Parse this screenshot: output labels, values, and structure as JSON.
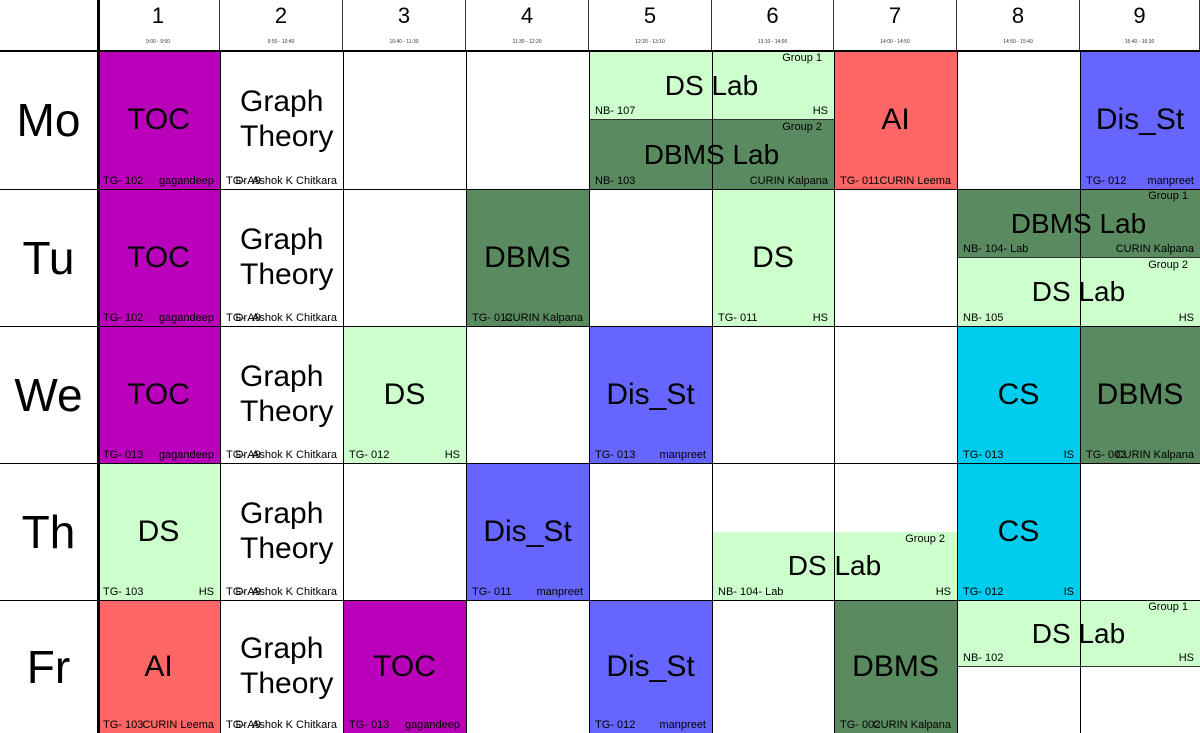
{
  "colors": {
    "toc": "#bb00bb",
    "graph": "#ffffff",
    "ds": "#ccffcc",
    "dbms": "#5a8a5f",
    "ai": "#ff6666",
    "dis": "#6666ff",
    "cs": "#00ccee"
  },
  "periods": [
    {
      "num": "1",
      "time": "9:00 - 9:50"
    },
    {
      "num": "2",
      "time": "9:50 - 10:40"
    },
    {
      "num": "3",
      "time": "10:40 - 11:30"
    },
    {
      "num": "4",
      "time": "11:30 - 12:20"
    },
    {
      "num": "5",
      "time": "12:20 - 13:10"
    },
    {
      "num": "6",
      "time": "13:10 - 14:00"
    },
    {
      "num": "7",
      "time": "14:00 - 14:50"
    },
    {
      "num": "8",
      "time": "14:50 - 15:40"
    },
    {
      "num": "9",
      "time": "15:40 - 16:30"
    }
  ],
  "days": [
    "Mo",
    "Tu",
    "We",
    "Th",
    "Fr"
  ],
  "entries": [
    {
      "day": 0,
      "p": 1,
      "span": 1,
      "part": "full",
      "subject": "TOC",
      "color": "toc",
      "room": "TG- 102",
      "teacher": "gagandeep"
    },
    {
      "day": 0,
      "p": 2,
      "span": 1,
      "part": "full",
      "subject": "Graph Theory",
      "color": "graph",
      "room": "TG- A9",
      "teacher": "Dr. Ashok K Chitkara"
    },
    {
      "day": 0,
      "p": 5,
      "span": 2,
      "part": "top",
      "subject": "DS Lab",
      "group": "Group 1",
      "color": "ds",
      "room": "NB- 107",
      "teacher": "HS"
    },
    {
      "day": 0,
      "p": 5,
      "span": 2,
      "part": "bottom",
      "subject": "DBMS Lab",
      "group": "Group 2",
      "color": "dbms",
      "room": "NB- 103",
      "teacher": "CURIN Kalpana"
    },
    {
      "day": 0,
      "p": 7,
      "span": 1,
      "part": "full",
      "subject": "AI",
      "color": "ai",
      "room": "TG- 011",
      "teacher": "CURIN Leema"
    },
    {
      "day": 0,
      "p": 9,
      "span": 1,
      "part": "full",
      "subject": "Dis_St",
      "color": "dis",
      "room": "TG- 012",
      "teacher": "manpreet"
    },
    {
      "day": 1,
      "p": 1,
      "span": 1,
      "part": "full",
      "subject": "TOC",
      "color": "toc",
      "room": "TG- 102",
      "teacher": "gagandeep"
    },
    {
      "day": 1,
      "p": 2,
      "span": 1,
      "part": "full",
      "subject": "Graph Theory",
      "color": "graph",
      "room": "TG- A9",
      "teacher": "Dr. Ashok K Chitkara"
    },
    {
      "day": 1,
      "p": 4,
      "span": 1,
      "part": "full",
      "subject": "DBMS",
      "color": "dbms",
      "room": "TG- 012",
      "teacher": "CURIN Kalpana"
    },
    {
      "day": 1,
      "p": 6,
      "span": 1,
      "part": "full",
      "subject": "DS",
      "color": "ds",
      "room": "TG- 011",
      "teacher": "HS"
    },
    {
      "day": 1,
      "p": 8,
      "span": 2,
      "part": "top",
      "subject": "DBMS Lab",
      "group": "Group 1",
      "color": "dbms",
      "room": "NB- 104- Lab",
      "teacher": "CURIN Kalpana"
    },
    {
      "day": 1,
      "p": 8,
      "span": 2,
      "part": "bottom",
      "subject": "DS Lab",
      "group": "Group 2",
      "color": "ds",
      "room": "NB- 105",
      "teacher": "HS"
    },
    {
      "day": 2,
      "p": 1,
      "span": 1,
      "part": "full",
      "subject": "TOC",
      "color": "toc",
      "room": "TG- 013",
      "teacher": "gagandeep"
    },
    {
      "day": 2,
      "p": 2,
      "span": 1,
      "part": "full",
      "subject": "Graph Theory",
      "color": "graph",
      "room": "TG- A9",
      "teacher": "Dr. Ashok K Chitkara"
    },
    {
      "day": 2,
      "p": 3,
      "span": 1,
      "part": "full",
      "subject": "DS",
      "color": "ds",
      "room": "TG- 012",
      "teacher": "HS"
    },
    {
      "day": 2,
      "p": 5,
      "span": 1,
      "part": "full",
      "subject": "Dis_St",
      "color": "dis",
      "room": "TG- 013",
      "teacher": "manpreet"
    },
    {
      "day": 2,
      "p": 8,
      "span": 1,
      "part": "full",
      "subject": "CS",
      "color": "cs",
      "room": "TG- 013",
      "teacher": "IS"
    },
    {
      "day": 2,
      "p": 9,
      "span": 1,
      "part": "full",
      "subject": "DBMS",
      "color": "dbms",
      "room": "TG- 003",
      "teacher": "CURIN Kalpana"
    },
    {
      "day": 3,
      "p": 1,
      "span": 1,
      "part": "full",
      "subject": "DS",
      "color": "ds",
      "room": "TG- 103",
      "teacher": "HS"
    },
    {
      "day": 3,
      "p": 2,
      "span": 1,
      "part": "full",
      "subject": "Graph Theory",
      "color": "graph",
      "room": "TG- A9",
      "teacher": "Dr. Ashok K Chitkara"
    },
    {
      "day": 3,
      "p": 4,
      "span": 1,
      "part": "full",
      "subject": "Dis_St",
      "color": "dis",
      "room": "TG- 011",
      "teacher": "manpreet"
    },
    {
      "day": 3,
      "p": 6,
      "span": 2,
      "part": "bottom",
      "subject": "DS Lab",
      "group": "Group 2",
      "color": "ds",
      "room": "NB- 104- Lab",
      "teacher": "HS"
    },
    {
      "day": 3,
      "p": 8,
      "span": 1,
      "part": "full",
      "subject": "CS",
      "color": "cs",
      "room": "TG- 012",
      "teacher": "IS"
    },
    {
      "day": 4,
      "p": 1,
      "span": 1,
      "part": "full",
      "subject": "AI",
      "color": "ai",
      "room": "TG- 103",
      "teacher": "CURIN Leema"
    },
    {
      "day": 4,
      "p": 2,
      "span": 1,
      "part": "full",
      "subject": "Graph Theory",
      "color": "graph",
      "room": "TG- A9",
      "teacher": "Dr. Ashok K Chitkara"
    },
    {
      "day": 4,
      "p": 3,
      "span": 1,
      "part": "full",
      "subject": "TOC",
      "color": "toc",
      "room": "TG- 013",
      "teacher": "gagandeep"
    },
    {
      "day": 4,
      "p": 5,
      "span": 1,
      "part": "full",
      "subject": "Dis_St",
      "color": "dis",
      "room": "TG- 012",
      "teacher": "manpreet"
    },
    {
      "day": 4,
      "p": 7,
      "span": 1,
      "part": "full",
      "subject": "DBMS",
      "color": "dbms",
      "room": "TG- 002",
      "teacher": "CURIN Kalpana"
    },
    {
      "day": 4,
      "p": 8,
      "span": 2,
      "part": "top",
      "subject": "DS Lab",
      "group": "Group 1",
      "color": "ds",
      "room": "NB- 102",
      "teacher": "HS"
    }
  ]
}
